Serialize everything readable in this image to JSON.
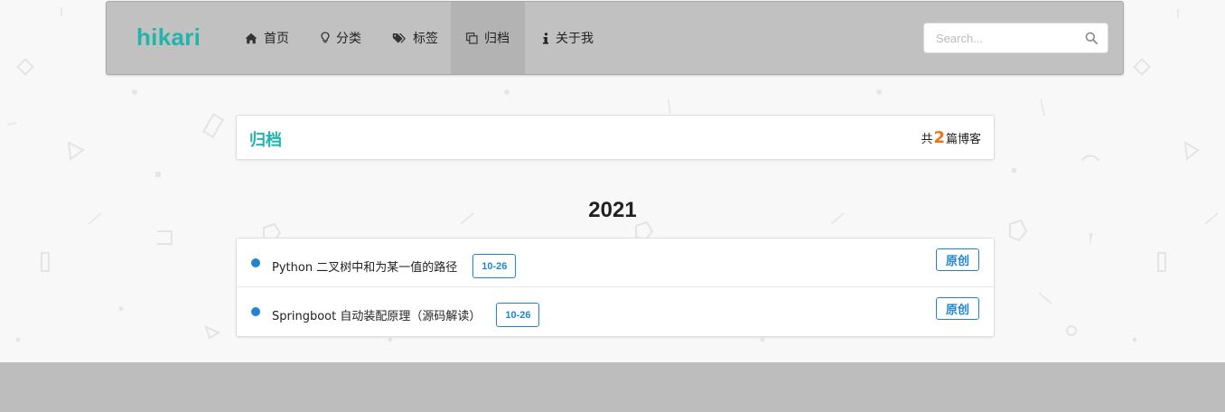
{
  "header": {
    "brand": "hikari",
    "nav": [
      {
        "label": "首页",
        "icon": "home-icon"
      },
      {
        "label": "分类",
        "icon": "lightbulb-icon"
      },
      {
        "label": "标签",
        "icon": "tags-icon"
      },
      {
        "label": "归档",
        "icon": "clone-icon"
      },
      {
        "label": "关于我",
        "icon": "info-icon"
      }
    ],
    "active_nav": "归档",
    "search": {
      "placeholder": "Search...",
      "value": "",
      "icon": "search-icon"
    }
  },
  "archive": {
    "title": "归档",
    "count_prefix": "共",
    "count": "2",
    "count_suffix": "篇博客"
  },
  "year": "2021",
  "posts": [
    {
      "title": "Python 二叉树中和为某一值的路径",
      "date": "10-26",
      "type": "原创"
    },
    {
      "title": "Springboot 自动装配原理（源码解读）",
      "date": "10-26",
      "type": "原创"
    }
  ],
  "colors": {
    "brand": "#1fb5ac",
    "accent_blue": "#2185d0",
    "count_orange": "#f2711c",
    "menu_bg": "#c1c1c1",
    "footer_bg": "#bdbdbd"
  }
}
